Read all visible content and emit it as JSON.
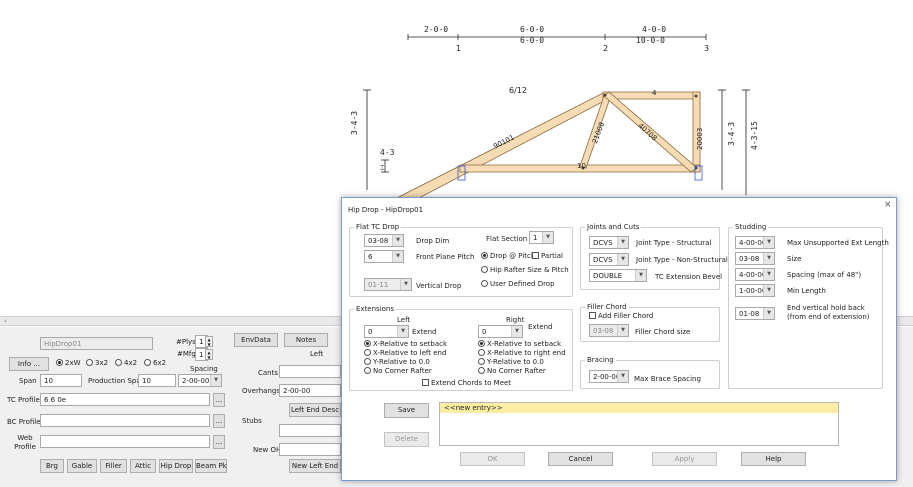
{
  "drawing": {
    "dim_top_1": "2-0-0",
    "dim_top_2": "6-0-0",
    "dim_top_3": "4-0-0",
    "dim_cum_2": "6-0-0",
    "dim_cum_3": "10-0-0",
    "panel_1": "1",
    "panel_2": "2",
    "panel_3": "3",
    "pitch": "6/12",
    "left_height": "3-4-3",
    "left_small": "4-3",
    "right_height_1": "3-4-3",
    "right_height_2": "4-3-15",
    "member_top": "4",
    "member_tc": "90101",
    "member_web1": "21008",
    "member_web2": "40708",
    "member_vert": "20003",
    "member_bc": "10"
  },
  "left_panel": {
    "name_value": "HipDrop01",
    "plys_label": "#Plys",
    "plys_value": "1",
    "mfg_label": "#Mfg",
    "mfg_value": "1",
    "info_label": "Info ...",
    "lumber": [
      "2xW",
      "3x2",
      "4x2",
      "6x2"
    ],
    "spacing_label": "Spacing",
    "span_label": "Span",
    "span_value": "10",
    "prod_span_label": "Production Span",
    "prod_span_value": "10",
    "spacing_value": "2-00-00",
    "tc_profile_label": "TC Profile",
    "tc_profile_value": "6 6 0e",
    "bc_profile_label": "BC Profile",
    "web_profile_label": "Web Profile",
    "more": "...",
    "buttons": [
      "Brg",
      "Gable",
      "Filler",
      "Attic",
      "Hip Drop",
      "Beam Pk"
    ]
  },
  "mid_panel": {
    "envdata": "EnvData",
    "notes": "Notes",
    "left_header": "Left",
    "cants_label": "Cants",
    "overhangs_label": "Overhangs",
    "overhangs_value": "2-00-00",
    "left_end_desc": "Left End Desc",
    "stubs_label": "Stubs",
    "new_oh_label": "New OH",
    "new_left_end": "New Left End"
  },
  "dialog": {
    "title": "Hip Drop - HipDrop01",
    "close": "×",
    "flat_tc": {
      "group": "Flat TC Drop",
      "drop_dim_value": "03-08",
      "drop_dim_label": "Drop Dim",
      "flat_section_label": "Flat Section",
      "flat_section_value": "1",
      "front_plane_value": "6",
      "front_plane_label": "Front Plane Pitch",
      "drop_pitch": "Drop @ Pitch",
      "partial": "Partial",
      "hip_rafter": "Hip Rafter Size  & Pitch",
      "vertical_drop_value": "01-11",
      "vertical_drop_label": "Vertical Drop",
      "user_defined": "User Defined Drop"
    },
    "extensions": {
      "group": "Extensions",
      "left": "Left",
      "right": "Right",
      "left_value": "0",
      "right_value": "0",
      "extend": "Extend",
      "options": [
        "X-Relative to setback",
        "X-Relative to left end",
        "Y-Relative to 0.0",
        "No Corner Rafter"
      ],
      "options_right": [
        "X-Relative to setback",
        "X-Relative to right end",
        "Y-Relative to 0.0",
        "No Corner Rafter"
      ],
      "extend_chords": "Extend Chords to Meet"
    },
    "joints": {
      "group": "Joints and Cuts",
      "structural_value": "DCVS",
      "structural_label": "Joint Type - Structural",
      "nonstructural_value": "DCVS",
      "nonstructural_label": "Joint Type - Non-Structural",
      "bevel_value": "DOUBLE",
      "bevel_label": "TC Extension Bevel"
    },
    "filler": {
      "group": "Filler Chord",
      "add": "Add Filler Chord",
      "size_value": "03-08",
      "size_label": "Filler Chord size"
    },
    "bracing": {
      "group": "Bracing",
      "value": "2-00-00",
      "label": "Max Brace Spacing"
    },
    "studding": {
      "group": "Studding",
      "max_value": "4-00-00",
      "max_label": "Max Unsupported Ext Length",
      "size_value": "03-08",
      "size_label": "Size",
      "spacing_value": "4-00-00",
      "spacing_label": "Spacing (max of 48\")",
      "minlen_value": "1-00-00",
      "minlen_label": "Min Length",
      "holdback_value": "01-08",
      "holdback_label": "End vertical hold back (from end of extension)"
    },
    "save": "Save",
    "delete": "Delete",
    "entry": "<<new entry>>",
    "ok": "OK",
    "cancel": "Cancel",
    "apply": "Apply",
    "help": "Help"
  }
}
